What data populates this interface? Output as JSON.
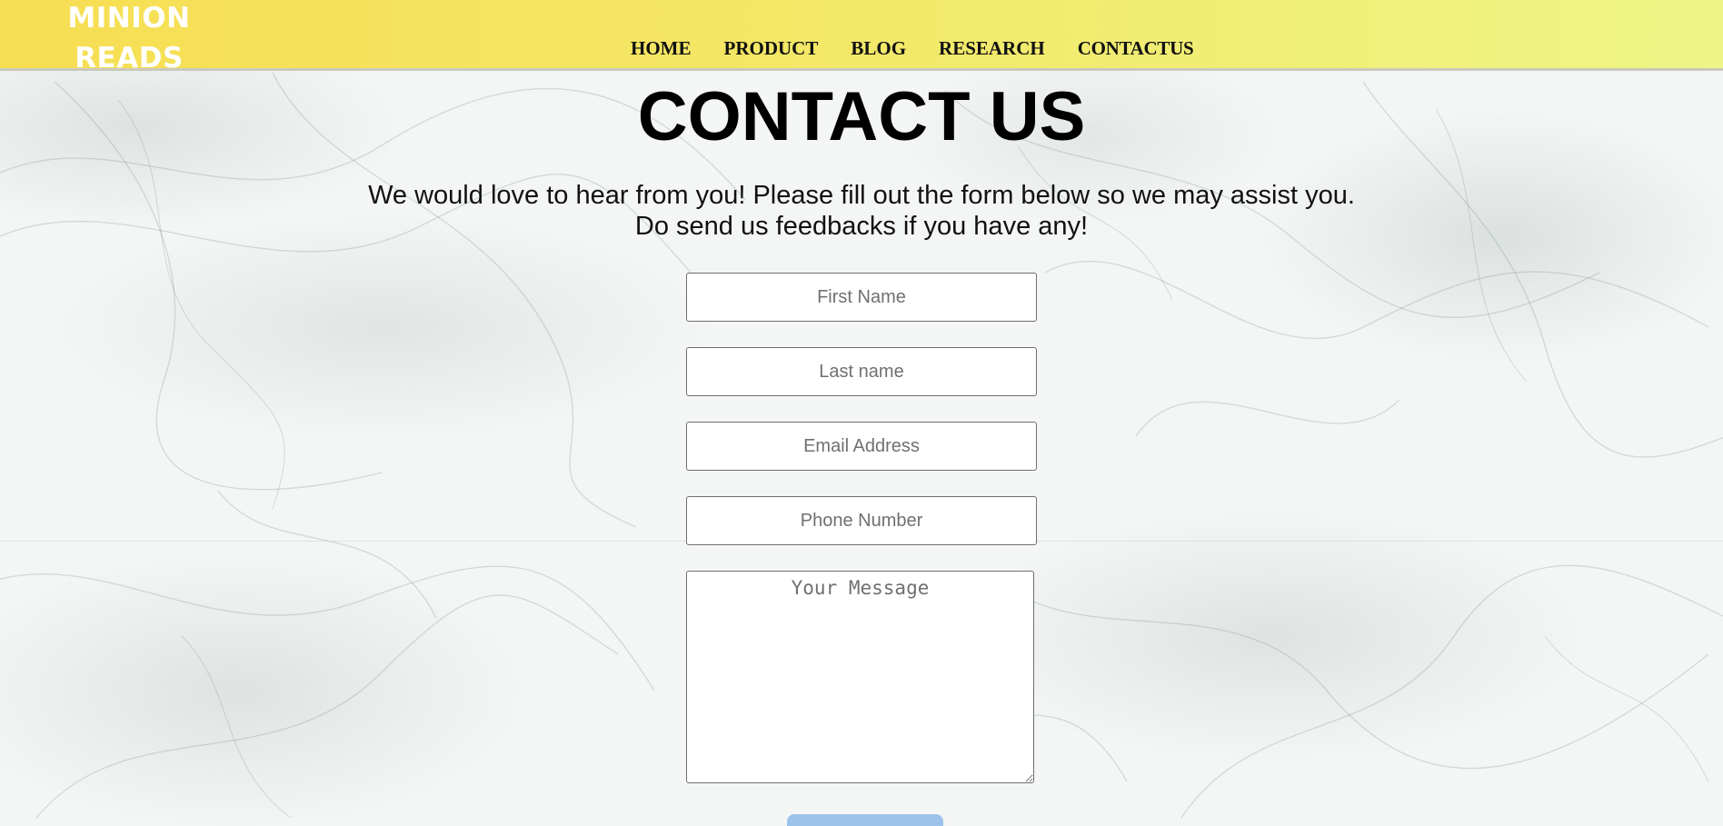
{
  "brand": {
    "logo_line1": "MINION",
    "logo_line2": "READS",
    "color": "#ffffff"
  },
  "nav": {
    "items": [
      {
        "label": "HOME"
      },
      {
        "label": "PRODUCT"
      },
      {
        "label": "BLOG"
      },
      {
        "label": "RESEARCH"
      },
      {
        "label": "CONTACTUS"
      }
    ]
  },
  "page": {
    "title": "CONTACT US",
    "intro_line1": "We would love to hear from you! Please fill out the form below so we may assist you.",
    "intro_line2": "Do send us feedbacks if you have any!"
  },
  "form": {
    "first_name": {
      "placeholder": "First Name",
      "value": ""
    },
    "last_name": {
      "placeholder": "Last name",
      "value": ""
    },
    "email": {
      "placeholder": "Email Address",
      "value": ""
    },
    "phone": {
      "placeholder": "Phone Number",
      "value": ""
    },
    "message": {
      "placeholder": "Your Message",
      "value": ""
    },
    "submit_label": ""
  },
  "colors": {
    "header_start": "#f6de52",
    "header_end": "#eef585",
    "submit_button": "#9cc3ea",
    "background": "#f4f6f5"
  }
}
